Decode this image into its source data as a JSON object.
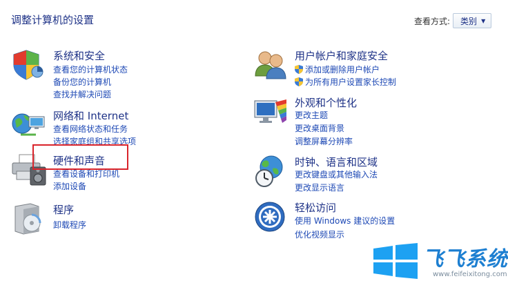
{
  "header": {
    "title": "调整计算机的设置",
    "view_by_label": "查看方式:",
    "view_by_value": "类别"
  },
  "categories": {
    "system": {
      "title": "系统和安全",
      "links": [
        "查看您的计算机状态",
        "备份您的计算机",
        "查找并解决问题"
      ]
    },
    "network": {
      "title": "网络和 Internet",
      "links": [
        "查看网络状态和任务",
        "选择家庭组和共享选项"
      ]
    },
    "hardware": {
      "title": "硬件和声音",
      "links": [
        "查看设备和打印机",
        "添加设备"
      ]
    },
    "programs": {
      "title": "程序",
      "links": [
        "卸载程序"
      ]
    },
    "accounts": {
      "title": "用户帐户和家庭安全",
      "links": [
        "添加或删除用户帐户",
        "为所有用户设置家长控制"
      ]
    },
    "appearance": {
      "title": "外观和个性化",
      "links": [
        "更改主题",
        "更改桌面背景",
        "调整屏幕分辨率"
      ]
    },
    "clock": {
      "title": "时钟、语言和区域",
      "links": [
        "更改键盘或其他输入法",
        "更改显示语言"
      ]
    },
    "ease": {
      "title": "轻松访问",
      "links": [
        "使用 Windows 建议的设置",
        "优化视频显示"
      ]
    }
  },
  "watermark": {
    "brand": "飞飞系统",
    "url": "www.feifeixitong.com"
  },
  "colors": {
    "title_blue": "#1e3287",
    "link_blue": "#1e49b5",
    "highlight_red": "#d9232a",
    "brand_blue": "#1d7fd1"
  },
  "icons": {
    "system": "shield-icon",
    "network": "globe-network-icon",
    "hardware": "printer-icon",
    "programs": "software-box-icon",
    "accounts": "users-icon",
    "appearance": "monitor-palette-icon",
    "clock": "globe-clock-icon",
    "ease": "accessibility-icon"
  }
}
